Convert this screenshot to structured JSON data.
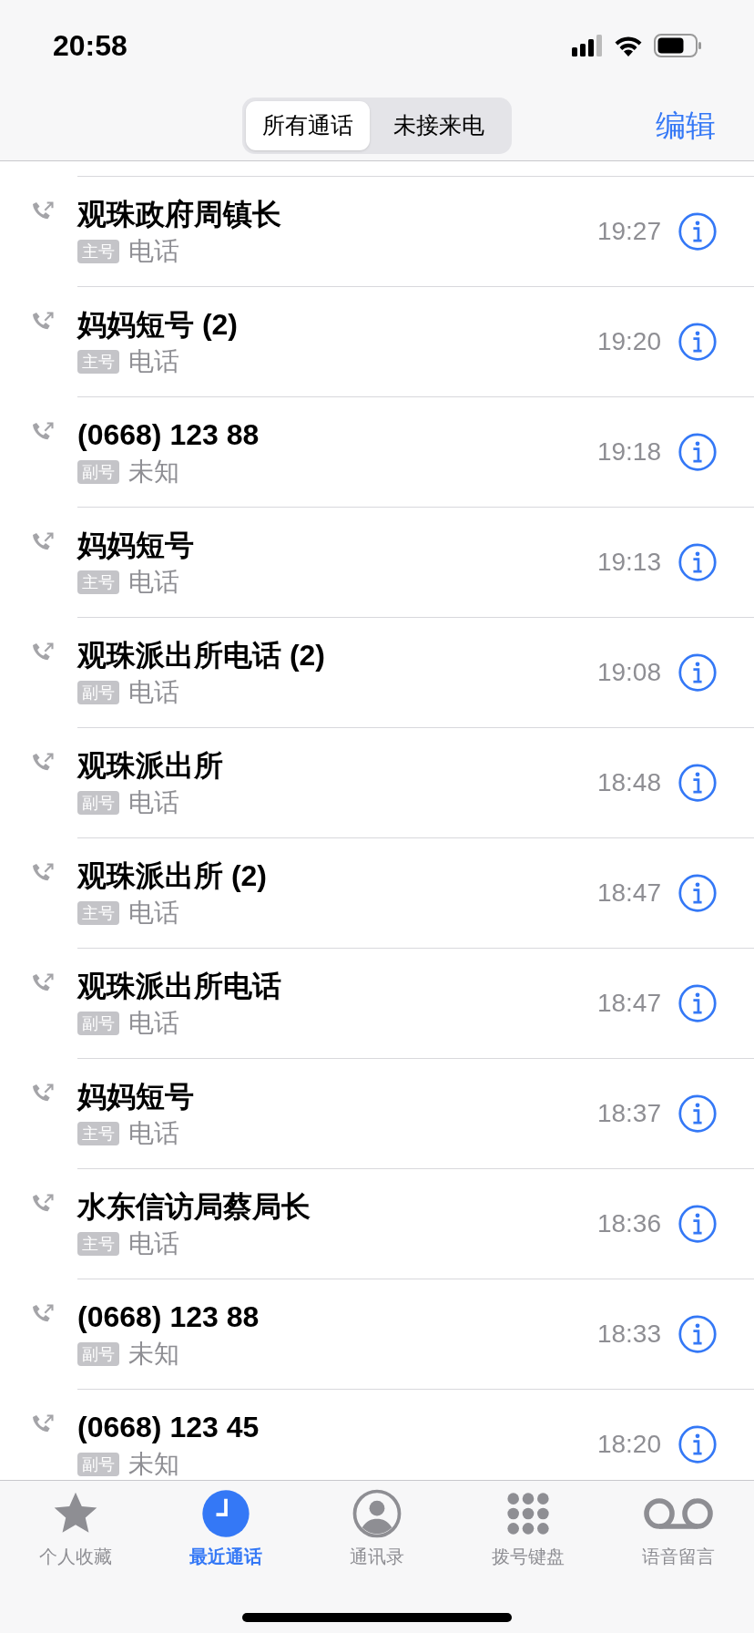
{
  "status_bar": {
    "time": "20:58"
  },
  "segments": [
    {
      "label": "所有通话",
      "selected": true
    },
    {
      "label": "未接来电",
      "selected": false
    }
  ],
  "edit_button": "编辑",
  "calls": [
    {
      "name": "观珠政府周镇长",
      "line": "主号",
      "type": "电话",
      "time": "19:27"
    },
    {
      "name": "妈妈短号 (2)",
      "line": "主号",
      "type": "电话",
      "time": "19:20"
    },
    {
      "name": "(0668) 123 88",
      "line": "副号",
      "type": "未知",
      "time": "19:18"
    },
    {
      "name": "妈妈短号",
      "line": "主号",
      "type": "电话",
      "time": "19:13"
    },
    {
      "name": "观珠派出所电话 (2)",
      "line": "副号",
      "type": "电话",
      "time": "19:08"
    },
    {
      "name": "观珠派出所",
      "line": "副号",
      "type": "电话",
      "time": "18:48"
    },
    {
      "name": "观珠派出所 (2)",
      "line": "主号",
      "type": "电话",
      "time": "18:47"
    },
    {
      "name": "观珠派出所电话",
      "line": "副号",
      "type": "电话",
      "time": "18:47"
    },
    {
      "name": "妈妈短号",
      "line": "主号",
      "type": "电话",
      "time": "18:37"
    },
    {
      "name": "水东信访局蔡局长",
      "line": "主号",
      "type": "电话",
      "time": "18:36"
    },
    {
      "name": "(0668) 123 88",
      "line": "副号",
      "type": "未知",
      "time": "18:33"
    },
    {
      "name": "(0668) 123 45",
      "line": "副号",
      "type": "未知",
      "time": "18:20"
    }
  ],
  "tab_bar": [
    {
      "kind": "favorites",
      "label": "个人收藏",
      "selected": false
    },
    {
      "kind": "recents",
      "label": "最近通话",
      "selected": true
    },
    {
      "kind": "contacts",
      "label": "通讯录",
      "selected": false
    },
    {
      "kind": "keypad",
      "label": "拨号键盘",
      "selected": false
    },
    {
      "kind": "voicemail",
      "label": "语音留言",
      "selected": false
    }
  ]
}
